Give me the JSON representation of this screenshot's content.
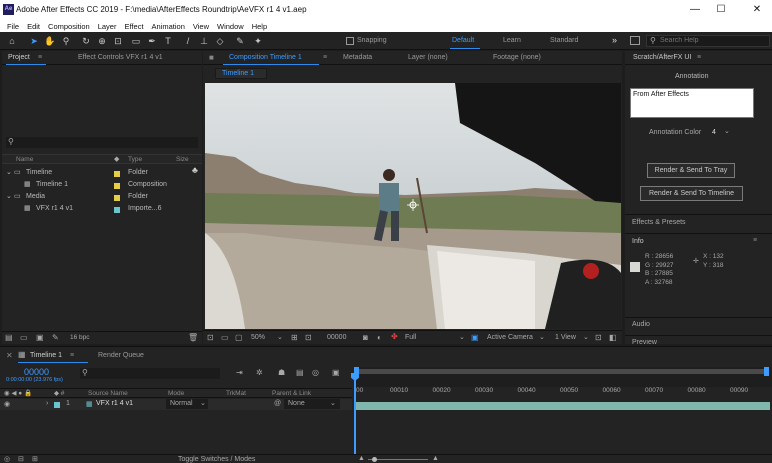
{
  "window": {
    "title": "Adobe After Effects CC 2019 - F:\\media\\AfterEffects Roundtrip\\AeVFX r1 4 v1.aep",
    "minimize": "—",
    "maximize": "☐",
    "close": "✕"
  },
  "menu": [
    "File",
    "Edit",
    "Composition",
    "Layer",
    "Effect",
    "Animation",
    "View",
    "Window",
    "Help"
  ],
  "toolbar": {
    "snapping": "Snapping",
    "workspaces": [
      "Default",
      "Learn",
      "Standard"
    ],
    "active_workspace": "Default",
    "more": "»",
    "search_placeholder": "Search Help"
  },
  "project": {
    "tabs": [
      "Project",
      "Effect Controls VFX r1 4 v1"
    ],
    "search_placeholder": "",
    "columns": {
      "name": "Name",
      "type": "Type",
      "size": "Size"
    },
    "items": [
      {
        "indent": 0,
        "expand": "⌄",
        "label": "Timeline",
        "type": "Folder",
        "color": "#e6cd47"
      },
      {
        "indent": 1,
        "expand": "",
        "label": "Timeline 1",
        "type": "Composition",
        "color": "#e6cd47"
      },
      {
        "indent": 0,
        "expand": "⌄",
        "label": "Media",
        "type": "Folder",
        "color": "#e6cd47"
      },
      {
        "indent": 1,
        "expand": "",
        "label": "VFX r1 4 v1",
        "type": "Importe...6",
        "color": "#6bc5cf"
      }
    ],
    "bpc": "16 bpc"
  },
  "viewer": {
    "tabs": [
      "Composition Timeline 1",
      "Metadata",
      "Layer (none)",
      "Footage (none)"
    ],
    "comp_tab_label": "Timeline 1",
    "zoom": "50%",
    "timecode": "00000",
    "resolution": "Full",
    "camera": "Active Camera",
    "views": "1 View"
  },
  "right": {
    "panel_title": "Scratch/AfterFX UI",
    "annotation_label": "Annotation",
    "annotation_text": "From After Effects",
    "annotation_color_label": "Annotation Color",
    "annotation_color_value": "4",
    "button_tray": "Render & Send To Tray",
    "button_timeline": "Render & Send To Timeline",
    "effects_title": "Effects & Presets",
    "info_title": "Info",
    "info": {
      "r": "R : 28656",
      "g": "G : 29927",
      "b": "B : 27885",
      "a": "A : 32768",
      "x": "X : 132",
      "y": "Y : 318"
    },
    "audio_title": "Audio",
    "preview_title": "Preview"
  },
  "timeline": {
    "tab": "Timeline 1",
    "render_queue": "Render Queue",
    "timecode": "00000",
    "timecode_sub": "0:00:00:00 (23.976 fps)",
    "columns": {
      "source": "Source Name",
      "mode": "Mode",
      "trkmat": "TrkMat",
      "parent": "Parent & Link"
    },
    "layer": {
      "index": "1",
      "name": "VFX r1 4 v1",
      "mode": "Normal",
      "parent": "None"
    },
    "ruler": [
      "00010",
      "00020",
      "00030",
      "00040",
      "00050",
      "00060",
      "00070",
      "00080",
      "00090"
    ],
    "ruler_start": "00",
    "toggle": "Toggle Switches / Modes"
  },
  "colors": {
    "accent": "#2d8ceb",
    "layer_bar": "#7fb7ad",
    "folder": "#e6cd47",
    "footage": "#6bc5cf"
  }
}
